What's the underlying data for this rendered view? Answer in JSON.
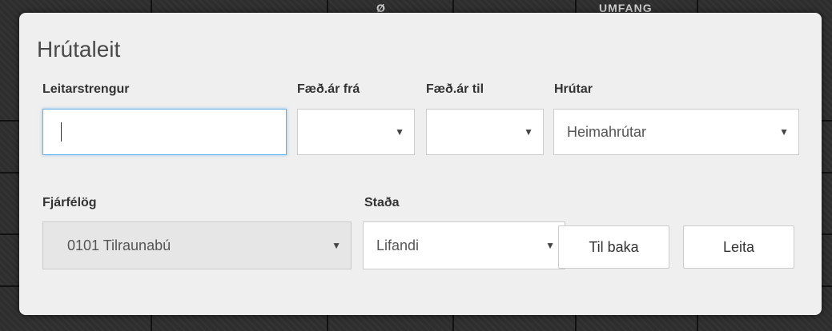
{
  "background": {
    "header_fragments": [
      "Ø",
      "UMFANG"
    ]
  },
  "dialog": {
    "title": "Hrútaleit",
    "search": {
      "label": "Leitarstrengur",
      "value": "",
      "placeholder": ""
    },
    "birth_year_from": {
      "label": "Fæð.ár frá",
      "selected": ""
    },
    "birth_year_to": {
      "label": "Fæð.ár til",
      "selected": ""
    },
    "rams": {
      "label": "Hrútar",
      "selected": "Heimahrútar"
    },
    "association": {
      "label": "Fjárfélög",
      "selected": "0101 Tilraunabú",
      "disabled": true
    },
    "status": {
      "label": "Staða",
      "selected": "Lifandi"
    },
    "buttons": {
      "back_label": "Til baka",
      "search_label": "Leita"
    },
    "icons": {
      "dropdown_arrow": "▼"
    }
  },
  "colors": {
    "focus_border": "#66afe9",
    "panel_bg": "#efefef",
    "backdrop": "#2e2e2e"
  }
}
